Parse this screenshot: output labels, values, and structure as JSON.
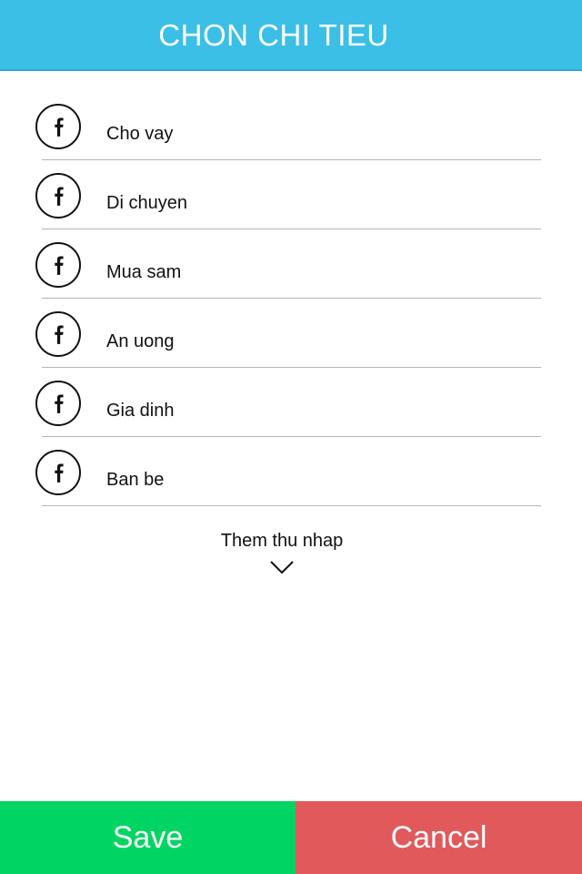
{
  "header": {
    "title": "CHON CHI TIEU"
  },
  "categories": [
    {
      "label": "Cho vay",
      "icon": "facebook-icon"
    },
    {
      "label": "Di chuyen",
      "icon": "facebook-icon"
    },
    {
      "label": "Mua sam",
      "icon": "facebook-icon"
    },
    {
      "label": "An uong",
      "icon": "facebook-icon"
    },
    {
      "label": "Gia dinh",
      "icon": "facebook-icon"
    },
    {
      "label": "Ban be",
      "icon": "facebook-icon"
    }
  ],
  "more": {
    "label": "Them thu nhap",
    "icon": "chevron-down-icon"
  },
  "footer": {
    "save_label": "Save",
    "cancel_label": "Cancel"
  },
  "colors": {
    "header": "#3bbfe6",
    "save": "#00d563",
    "cancel": "#e05a5c"
  }
}
